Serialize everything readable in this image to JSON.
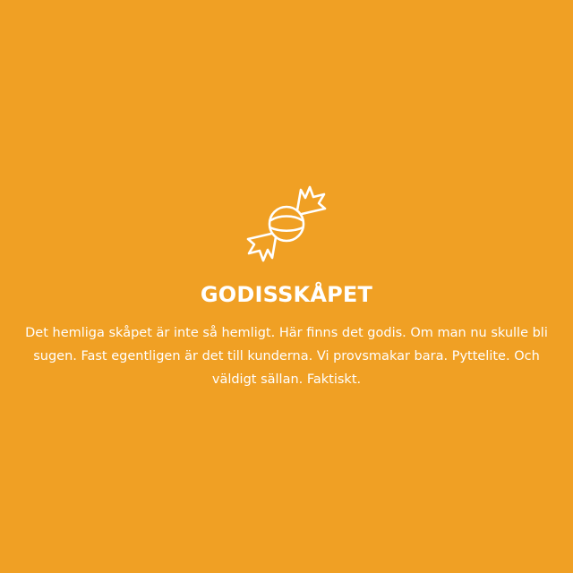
{
  "card": {
    "icon": "candy-icon",
    "title": "GODISSKÅPET",
    "description": "Det hemliga skåpet är inte så hemligt. Här finns det godis. Om man nu skulle bli sugen. Fast egentligen är det till kunderna. Vi provsmakar bara. Pyttelite. Och väldigt sällan. Faktiskt."
  },
  "colors": {
    "background": "#f0a024",
    "foreground": "#ffffff"
  }
}
